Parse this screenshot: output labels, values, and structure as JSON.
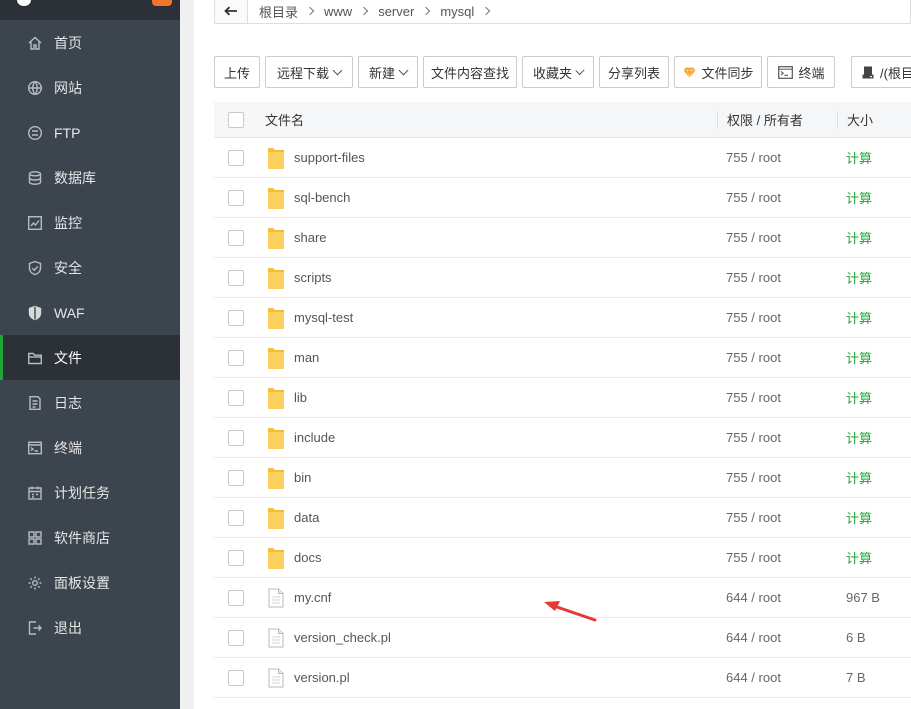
{
  "sidebar": {
    "items": [
      {
        "label": "首页",
        "icon": "home-icon"
      },
      {
        "label": "网站",
        "icon": "globe-icon"
      },
      {
        "label": "FTP",
        "icon": "ftp-icon"
      },
      {
        "label": "数据库",
        "icon": "database-icon"
      },
      {
        "label": "监控",
        "icon": "monitor-icon"
      },
      {
        "label": "安全",
        "icon": "shield-check-icon"
      },
      {
        "label": "WAF",
        "icon": "waf-shield-icon"
      },
      {
        "label": "文件",
        "icon": "folder-icon",
        "active": true
      },
      {
        "label": "日志",
        "icon": "log-icon"
      },
      {
        "label": "终端",
        "icon": "terminal-icon"
      },
      {
        "label": "计划任务",
        "icon": "calendar-icon"
      },
      {
        "label": "软件商店",
        "icon": "grid-icon"
      },
      {
        "label": "面板设置",
        "icon": "gear-icon"
      },
      {
        "label": "退出",
        "icon": "logout-icon"
      }
    ]
  },
  "breadcrumb": [
    "根目录",
    "www",
    "server",
    "mysql"
  ],
  "toolbar": {
    "upload": "上传",
    "remote_download": "远程下载",
    "new": "新建",
    "content_search": "文件内容查找",
    "favorites": "收藏夹",
    "share_list": "分享列表",
    "file_sync": "文件同步",
    "terminal": "终端",
    "disk": "/(根目"
  },
  "table": {
    "headers": {
      "name": "文件名",
      "perm": "权限 / 所有者",
      "size": "大小"
    },
    "rows": [
      {
        "name": "support-files",
        "perm": "755 / root",
        "size": "计算",
        "type": "folder"
      },
      {
        "name": "sql-bench",
        "perm": "755 / root",
        "size": "计算",
        "type": "folder"
      },
      {
        "name": "share",
        "perm": "755 / root",
        "size": "计算",
        "type": "folder"
      },
      {
        "name": "scripts",
        "perm": "755 / root",
        "size": "计算",
        "type": "folder"
      },
      {
        "name": "mysql-test",
        "perm": "755 / root",
        "size": "计算",
        "type": "folder"
      },
      {
        "name": "man",
        "perm": "755 / root",
        "size": "计算",
        "type": "folder"
      },
      {
        "name": "lib",
        "perm": "755 / root",
        "size": "计算",
        "type": "folder"
      },
      {
        "name": "include",
        "perm": "755 / root",
        "size": "计算",
        "type": "folder"
      },
      {
        "name": "bin",
        "perm": "755 / root",
        "size": "计算",
        "type": "folder"
      },
      {
        "name": "data",
        "perm": "755 / root",
        "size": "计算",
        "type": "folder"
      },
      {
        "name": "docs",
        "perm": "755 / root",
        "size": "计算",
        "type": "folder"
      },
      {
        "name": "my.cnf",
        "perm": "644 / root",
        "size": "967 B",
        "type": "file"
      },
      {
        "name": "version_check.pl",
        "perm": "644 / root",
        "size": "6 B",
        "type": "file"
      },
      {
        "name": "version.pl",
        "perm": "644 / root",
        "size": "7 B",
        "type": "file"
      }
    ]
  },
  "colors": {
    "sidebar_bg": "#3c444d",
    "active_accent": "#20a53a",
    "folder": "#f6c443",
    "calc_link": "#20a53a",
    "annotation_arrow": "#e53935"
  }
}
